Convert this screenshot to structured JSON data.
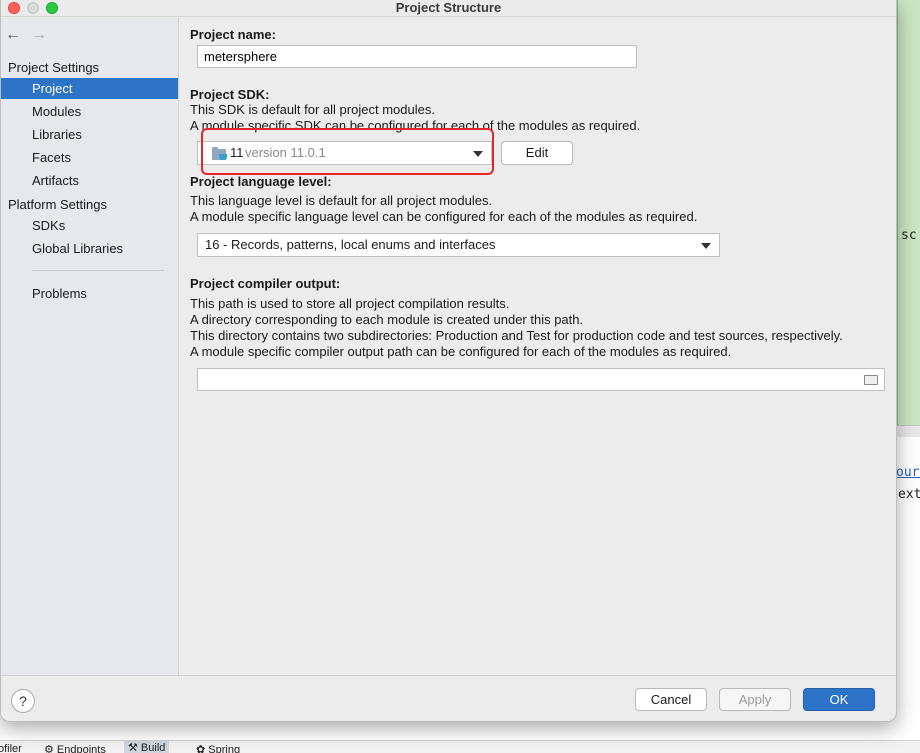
{
  "window": {
    "title": "Project Structure"
  },
  "nav": {
    "back": "←",
    "forward": "→"
  },
  "sidebar": {
    "group_project_settings": "Project Settings",
    "items_project": [
      "Project",
      "Modules",
      "Libraries",
      "Facets",
      "Artifacts"
    ],
    "group_platform_settings": "Platform Settings",
    "items_platform": [
      "SDKs",
      "Global Libraries"
    ],
    "problems": "Problems",
    "selected": "Project"
  },
  "project_name": {
    "label": "Project name:",
    "value": "metersphere"
  },
  "project_sdk": {
    "label": "Project SDK:",
    "desc_1": "This SDK is default for all project modules.",
    "desc_2": "A module specific SDK can be configured for each of the modules as required.",
    "selected_name": "11",
    "selected_version": "version 11.0.1",
    "edit_button": "Edit",
    "highlight_color": "#e5272d"
  },
  "language_level": {
    "label": "Project language level:",
    "desc_1": "This language level is default for all project modules.",
    "desc_2": "A module specific language level can be configured for each of the modules as required.",
    "selected": "16 - Records, patterns, local enums and interfaces"
  },
  "compiler_output": {
    "label": "Project compiler output:",
    "desc_1": "This path is used to store all project compilation results.",
    "desc_2": "A directory corresponding to each module is created under this path.",
    "desc_3": "This directory contains two subdirectories: Production and Test for production code and test sources, respectively.",
    "desc_4": "A module specific compiler output path can be configured for each of the modules as required.",
    "value": ""
  },
  "footer": {
    "help": "?",
    "cancel": "Cancel",
    "apply": "Apply",
    "ok": "OK",
    "accent": "#2d73c8"
  },
  "background": {
    "code_text": "sc",
    "link_text": "ourc",
    "code_text_2": "ext",
    "bottom_tabs": [
      "ofiler",
      "Endpoints",
      "Build",
      "Spring"
    ]
  }
}
